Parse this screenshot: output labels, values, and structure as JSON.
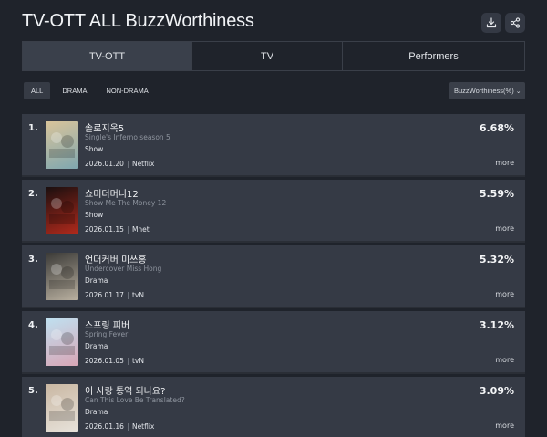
{
  "page": {
    "title": "TV-OTT ALL BuzzWorthiness"
  },
  "toolbar": {
    "download_icon": "download-icon",
    "share_icon": "share-icon"
  },
  "tabs": [
    {
      "label": "TV-OTT",
      "active": true
    },
    {
      "label": "TV",
      "active": false
    },
    {
      "label": "Performers",
      "active": false
    }
  ],
  "filters": [
    {
      "label": "ALL",
      "active": true
    },
    {
      "label": "DRAMA",
      "active": false
    },
    {
      "label": "NON-DRAMA",
      "active": false
    }
  ],
  "sort": {
    "label": "BuzzWorthiness(%)",
    "caret": "⌄"
  },
  "items": [
    {
      "rank": "1.",
      "korean_title": "솔로지옥5",
      "english_title": "Single's Inferno season 5",
      "genre": "Show",
      "date": "2026.01.20",
      "channel": "Netflix",
      "percent": "6.68%",
      "more": "more",
      "poster_colors": [
        "#d9c49a",
        "#7fa7b0"
      ]
    },
    {
      "rank": "2.",
      "korean_title": "쇼미더머니12",
      "english_title": "Show Me The Money 12",
      "genre": "Show",
      "date": "2026.01.15",
      "channel": "Mnet",
      "percent": "5.59%",
      "more": "more",
      "poster_colors": [
        "#1a0f0f",
        "#b22a1c"
      ]
    },
    {
      "rank": "3.",
      "korean_title": "언더커버 미쓰홍",
      "english_title": "Undercover Miss Hong",
      "genre": "Drama",
      "date": "2026.01.17",
      "channel": "tvN",
      "percent": "5.32%",
      "more": "more",
      "poster_colors": [
        "#3b3a37",
        "#b9b0a0"
      ]
    },
    {
      "rank": "4.",
      "korean_title": "스프링 피버",
      "english_title": "Spring Fever",
      "genre": "Drama",
      "date": "2026.01.05",
      "channel": "tvN",
      "percent": "3.12%",
      "more": "more",
      "poster_colors": [
        "#bfe0f0",
        "#d8a6b6"
      ]
    },
    {
      "rank": "5.",
      "korean_title": "이 사랑 통역 되나요?",
      "english_title": "Can This Love Be Translated?",
      "genre": "Drama",
      "date": "2026.01.16",
      "channel": "Netflix",
      "percent": "3.09%",
      "more": "more",
      "poster_colors": [
        "#c9b7a2",
        "#e7e2da"
      ]
    }
  ]
}
